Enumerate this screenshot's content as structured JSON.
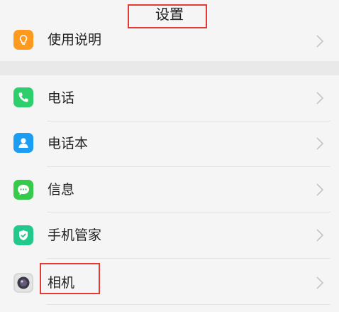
{
  "header": {
    "title": "设置"
  },
  "items": [
    {
      "label": "使用说明",
      "icon": "lightbulb-icon",
      "color": "#ff9a1f"
    },
    {
      "label": "电话",
      "icon": "phone-icon",
      "color": "#2ccf6b"
    },
    {
      "label": "电话本",
      "icon": "contacts-icon",
      "color": "#1a9df2"
    },
    {
      "label": "信息",
      "icon": "message-icon",
      "color": "#36c94a"
    },
    {
      "label": "手机管家",
      "icon": "shield-icon",
      "color": "#21c98a"
    },
    {
      "label": "相机",
      "icon": "camera-icon",
      "color": "#d8d8d8"
    }
  ],
  "highlight_color": "#e53935"
}
